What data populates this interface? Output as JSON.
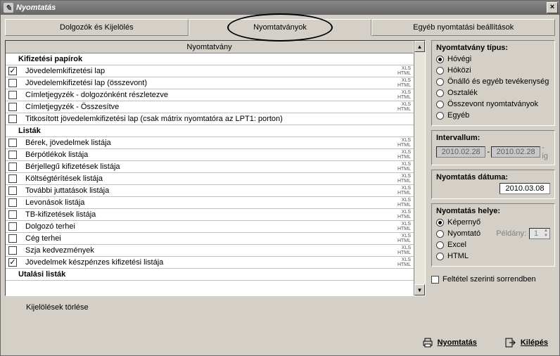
{
  "window": {
    "title": "Nyomtatás"
  },
  "tabs": {
    "employees": "Dolgozók és Kijelölés",
    "forms": "Nyomtatványok",
    "other": "Egyéb nyomtatási beállítások"
  },
  "grid": {
    "header": "Nyomtatvány",
    "clear_selection": "Kijelölések törlése",
    "sections": [
      {
        "title": "Kifizetési papírok",
        "items": [
          {
            "label": "Jövedelemkifizetési lap",
            "checked": true,
            "formats": "XLS HTML"
          },
          {
            "label": "Jövedelemkifizetési lap (összevont)",
            "checked": false,
            "formats": "XLS HTML"
          },
          {
            "label": "Címletjegyzék - dolgozónként részletezve",
            "checked": false,
            "formats": "XLS HTML"
          },
          {
            "label": "Címletjegyzék - Összesítve",
            "checked": false,
            "formats": "XLS HTML"
          },
          {
            "label": "Titkosított jövedelemkifizetési lap (csak mátrix nyomtatóra az LPT1: porton)",
            "checked": false,
            "formats": ""
          }
        ]
      },
      {
        "title": "Listák",
        "items": [
          {
            "label": "Bérek, jövedelmek listája",
            "checked": false,
            "formats": "XLS HTML"
          },
          {
            "label": "Bérpótlékok listája",
            "checked": false,
            "formats": "XLS HTML"
          },
          {
            "label": "Bérjellegű kifizetések listája",
            "checked": false,
            "formats": "XLS HTML"
          },
          {
            "label": "Költségtérítések listája",
            "checked": false,
            "formats": "XLS HTML"
          },
          {
            "label": "További juttatások listája",
            "checked": false,
            "formats": "XLS HTML"
          },
          {
            "label": "Levonások listája",
            "checked": false,
            "formats": "XLS HTML"
          },
          {
            "label": "TB-kifizetések listája",
            "checked": false,
            "formats": "XLS HTML"
          },
          {
            "label": "Dolgozó terhei",
            "checked": false,
            "formats": "XLS HTML"
          },
          {
            "label": "Cég terhei",
            "checked": false,
            "formats": "XLS HTML"
          },
          {
            "label": "Szja kedvezmények",
            "checked": false,
            "formats": "XLS HTML"
          },
          {
            "label": "Jövedelmek készpénzes kifizetési listája",
            "checked": true,
            "formats": "XLS HTML"
          }
        ]
      },
      {
        "title": "Utalási listák",
        "items": []
      }
    ]
  },
  "panel": {
    "type_legend": "Nyomtatvány típus:",
    "types": [
      "Hóvégi",
      "Hóközi",
      "Önálló és egyéb tevékenység",
      "Osztalék",
      "Összevont nyomtatványok",
      "Egyéb"
    ],
    "type_selected": 0,
    "interval_legend": "Intervallum:",
    "interval_from": "2010.02.28",
    "interval_to": "2010.02.28",
    "interval_suffix": "-ig",
    "printdate_legend": "Nyomtatás dátuma:",
    "printdate": "2010.03.08",
    "place_legend": "Nyomtatás helye:",
    "places": [
      "Képernyő",
      "Nyomtató",
      "Excel",
      "HTML"
    ],
    "place_selected": 0,
    "peldany_label": "Példány:",
    "peldany_value": "1",
    "sort_label": "Feltétel szerinti sorrendben"
  },
  "footer": {
    "print": "Nyomtatás",
    "exit": "Kilépés"
  }
}
